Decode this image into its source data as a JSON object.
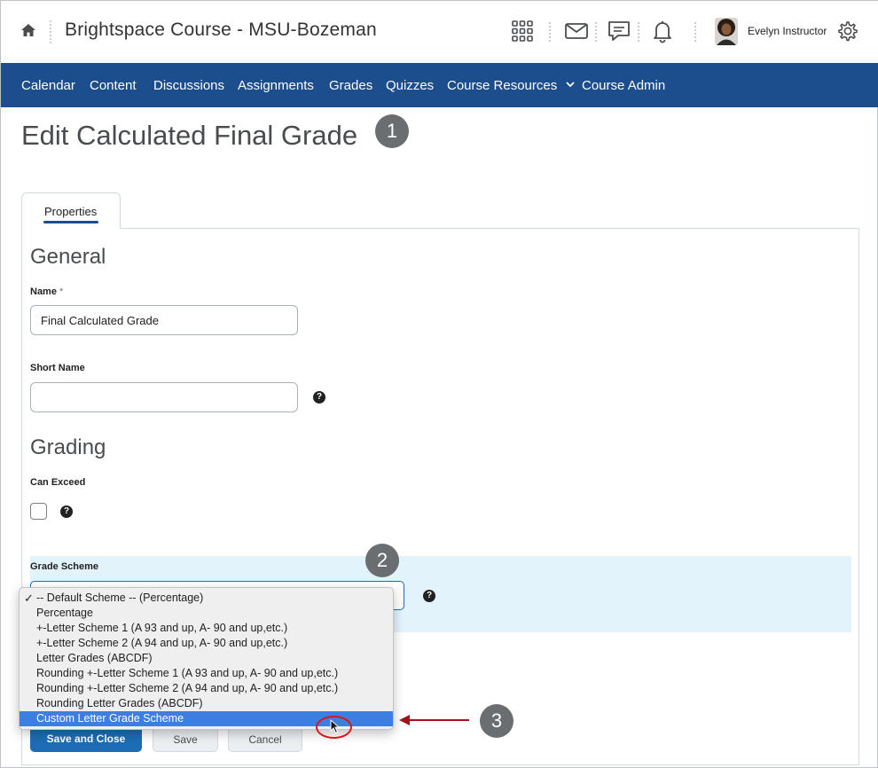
{
  "header": {
    "course_title": "Brightspace Course - MSU-Bozeman",
    "user_name": "Evelyn Instructor",
    "icons": [
      "home-icon",
      "apps-grid-icon",
      "mail-icon",
      "chat-icon",
      "bell-icon",
      "avatar",
      "gear-icon"
    ]
  },
  "nav": {
    "items": [
      "Calendar",
      "Content",
      "Discussions",
      "Assignments",
      "Grades",
      "Quizzes",
      "Course Resources",
      "Course Admin"
    ]
  },
  "page": {
    "title": "Edit Calculated Final Grade",
    "callouts": [
      "1",
      "2",
      "3"
    ]
  },
  "tabs": {
    "properties": "Properties"
  },
  "general": {
    "heading": "General",
    "name_label": "Name",
    "name_required": "*",
    "name_value": "Final Calculated Grade",
    "short_name_label": "Short Name",
    "short_name_value": ""
  },
  "grading": {
    "heading": "Grading",
    "can_exceed_label": "Can Exceed",
    "grade_scheme_label": "Grade Scheme",
    "grade_scheme_options": [
      "-- Default Scheme -- (Percentage)",
      "Percentage",
      "+-Letter Scheme 1 (A 93 and up, A- 90 and up,etc.)",
      "+-Letter Scheme 2 (A 94 and up, A- 90 and up,etc.)",
      "Letter Grades (ABCDF)",
      "Rounding +-Letter Scheme 1 (A 93 and up, A- 90 and up,etc.)",
      "Rounding +-Letter Scheme 2 (A 94 and up, A- 90 and up,etc.)",
      "Rounding Letter Grades (ABCDF)",
      "Custom Letter Grade Scheme"
    ],
    "checked_option": "-- Default Scheme -- (Percentage)",
    "highlighted_option": "Custom Letter Grade Scheme"
  },
  "buttons": {
    "save_and_close": "Save and Close",
    "save": "Save",
    "cancel": "Cancel"
  },
  "colors": {
    "nav_bg": "#1c4d8c",
    "primary": "#1c6db5",
    "callout": "#6b6e71",
    "annotation": "#a3121a",
    "highlight": "#3d7ee1"
  }
}
